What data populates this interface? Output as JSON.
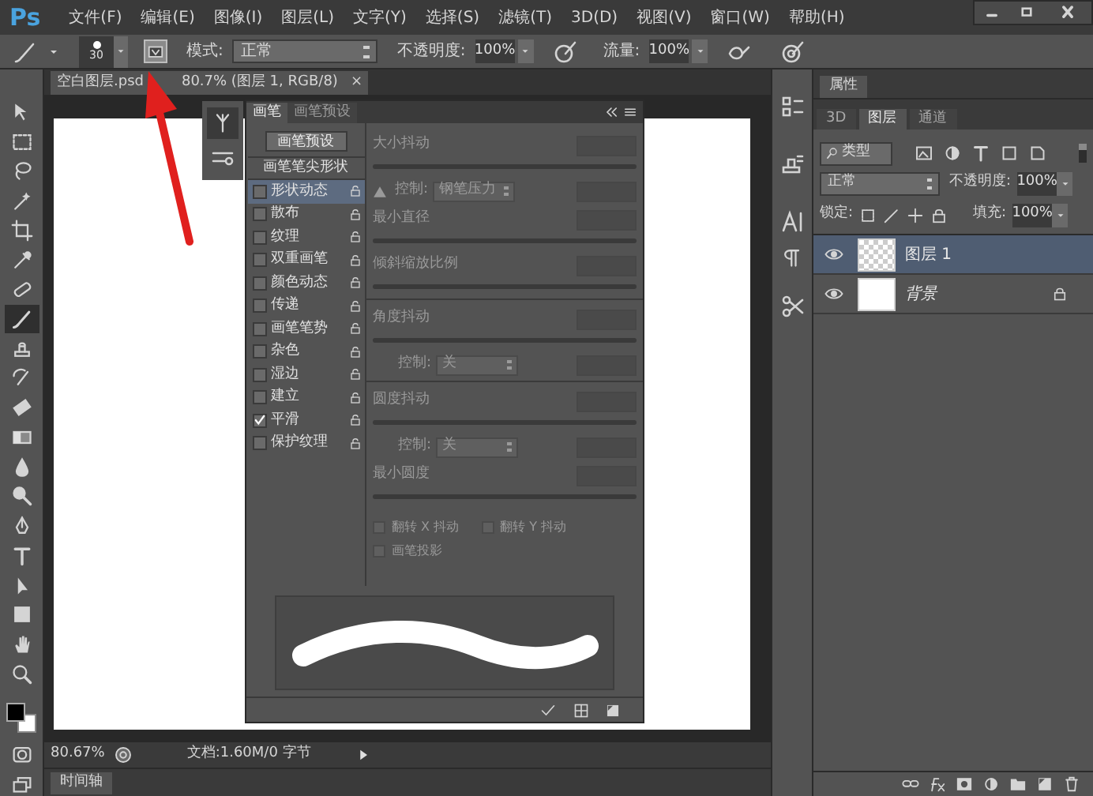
{
  "menu": {
    "logo": "Ps",
    "items": [
      "文件(F)",
      "编辑(E)",
      "图像(I)",
      "图层(L)",
      "文字(Y)",
      "选择(S)",
      "滤镜(T)",
      "3D(D)",
      "视图(V)",
      "窗口(W)",
      "帮助(H)"
    ]
  },
  "options_bar": {
    "brush_size": "30",
    "panel_toggle_on": true,
    "mode_label": "模式:",
    "mode": "正常",
    "opacity_label": "不透明度:",
    "opacity": "100%",
    "flow_label": "流量:",
    "flow": "100%"
  },
  "document_tab": {
    "name": "空白图层.psd",
    "info": "80.7% (图层 1, RGB/8)",
    "close": "×"
  },
  "tools": [
    {
      "kind": "move",
      "selected": false
    },
    {
      "kind": "marquee",
      "selected": false
    },
    {
      "kind": "lasso",
      "selected": false
    },
    {
      "kind": "wand",
      "selected": false
    },
    {
      "kind": "crop",
      "selected": false
    },
    {
      "kind": "eyedropper",
      "selected": false
    },
    {
      "kind": "heal",
      "selected": false
    },
    {
      "kind": "brush",
      "selected": true
    },
    {
      "kind": "stamp",
      "selected": false
    },
    {
      "kind": "history",
      "selected": false
    },
    {
      "kind": "eraser",
      "selected": false
    },
    {
      "kind": "gradient",
      "selected": false
    },
    {
      "kind": "blur",
      "selected": false
    },
    {
      "kind": "dodge",
      "selected": false
    },
    {
      "kind": "pen",
      "selected": false
    },
    {
      "kind": "type",
      "selected": false
    },
    {
      "kind": "select",
      "selected": false
    },
    {
      "kind": "shape",
      "selected": false
    },
    {
      "kind": "hand",
      "selected": false
    },
    {
      "kind": "zoom",
      "selected": false
    }
  ],
  "brush_panel": {
    "tabs": [
      {
        "label": "画笔",
        "selected": true
      },
      {
        "label": "画笔预设",
        "selected": false
      }
    ],
    "preset_button": "画笔预设",
    "tip_shape": "画笔笔尖形状",
    "options": [
      {
        "label": "形状动态",
        "checked": false,
        "selected": true
      },
      {
        "label": "散布",
        "checked": false,
        "selected": false
      },
      {
        "label": "纹理",
        "checked": false,
        "selected": false
      },
      {
        "label": "双重画笔",
        "checked": false,
        "selected": false
      },
      {
        "label": "颜色动态",
        "checked": false,
        "selected": false
      },
      {
        "label": "传递",
        "checked": false,
        "selected": false
      },
      {
        "label": "画笔笔势",
        "checked": false,
        "selected": false
      },
      {
        "label": "杂色",
        "checked": false,
        "selected": false
      },
      {
        "label": "湿边",
        "checked": false,
        "selected": false
      },
      {
        "label": "建立",
        "checked": false,
        "selected": false
      },
      {
        "label": "平滑",
        "checked": true,
        "selected": false
      },
      {
        "label": "保护纹理",
        "checked": false,
        "selected": false
      }
    ],
    "settings": [
      {
        "kind": "slider",
        "label": "大小抖动"
      },
      {
        "kind": "control",
        "label": "控制:",
        "value": "钢笔压力",
        "warning": true
      },
      {
        "kind": "slider",
        "label": "最小直径"
      },
      {
        "kind": "slider",
        "label": "倾斜缩放比例"
      },
      {
        "kind": "divider"
      },
      {
        "kind": "slider",
        "label": "角度抖动"
      },
      {
        "kind": "control",
        "label": "控制:",
        "value": "关",
        "warning": false
      },
      {
        "kind": "divider"
      },
      {
        "kind": "slider",
        "label": "圆度抖动"
      },
      {
        "kind": "control",
        "label": "控制:",
        "value": "关",
        "warning": false
      },
      {
        "kind": "slider",
        "label": "最小圆度"
      }
    ],
    "checkboxes": [
      {
        "label": "翻转 X 抖动",
        "checked": false
      },
      {
        "label": "翻转 Y 抖动",
        "checked": false
      },
      {
        "label": "画笔投影",
        "checked": false
      }
    ]
  },
  "layers_panel": {
    "header": "属性",
    "tabs": [
      {
        "label": "3D",
        "selected": false
      },
      {
        "label": "图层",
        "selected": true
      },
      {
        "label": "通道",
        "selected": false
      }
    ],
    "filter": "类型",
    "blend_mode": "正常",
    "opacity_label": "不透明度:",
    "opacity": "100%",
    "lock_label": "锁定:",
    "fill_label": "填充:",
    "fill": "100%",
    "layers": [
      {
        "name": "图层 1",
        "kind": "layer",
        "selected": true,
        "visible": true
      },
      {
        "name": "背景",
        "kind": "background",
        "selected": false,
        "visible": true
      }
    ]
  },
  "status_bar": {
    "zoom": "80.67%",
    "doc_info": "文档:1.60M/0 字节"
  },
  "timeline_tab": "时间轴"
}
